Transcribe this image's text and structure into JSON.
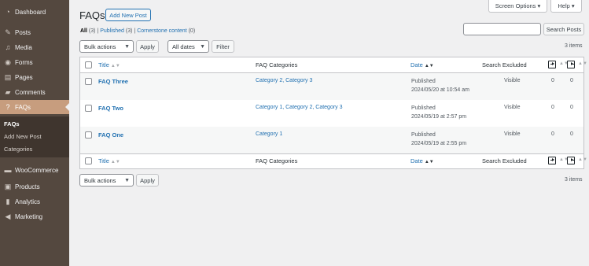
{
  "sidebar": {
    "items": [
      {
        "label": "Dashboard",
        "icon": "dashboard-icon"
      },
      {
        "label": "Posts",
        "icon": "pin-icon"
      },
      {
        "label": "Media",
        "icon": "media-icon"
      },
      {
        "label": "Forms",
        "icon": "forms-icon"
      },
      {
        "label": "Pages",
        "icon": "pages-icon"
      },
      {
        "label": "Comments",
        "icon": "comments-icon"
      },
      {
        "label": "FAQs",
        "icon": "help-icon"
      },
      {
        "label": "WooCommerce",
        "icon": "woocommerce-icon"
      },
      {
        "label": "Products",
        "icon": "products-icon"
      },
      {
        "label": "Analytics",
        "icon": "analytics-icon"
      },
      {
        "label": "Marketing",
        "icon": "megaphone-icon"
      }
    ],
    "submenu": [
      "FAQs",
      "Add New Post",
      "Categories"
    ]
  },
  "top": {
    "screen_options": "Screen Options ▾",
    "help": "Help ▾"
  },
  "header": {
    "title": "FAQs",
    "add_new": "Add New Post"
  },
  "views": {
    "all": "All",
    "all_count": "(3)",
    "published": "Published",
    "published_count": "(3)",
    "cornerstone": "Cornerstone content",
    "cornerstone_count": "(0)",
    "sep": "|"
  },
  "search": {
    "button": "Search Posts",
    "value": ""
  },
  "filters": {
    "bulk": "Bulk actions",
    "apply": "Apply",
    "dates": "All dates",
    "filter": "Filter"
  },
  "items_count": "3 items",
  "table": {
    "headers": {
      "title": "Title",
      "categories": "FAQ Categories",
      "date": "Date",
      "search_excluded": "Search Excluded"
    },
    "rows": [
      {
        "title": "FAQ Three",
        "categories": "Category 2, Category 3",
        "status": "Published",
        "date": "2024/05/20 at 10:54 am",
        "search": "Visible",
        "links_in": "0",
        "links_out": "0"
      },
      {
        "title": "FAQ Two",
        "categories": "Category 1, Category 2, Category 3",
        "status": "Published",
        "date": "2024/05/19 at 2:57 pm",
        "search": "Visible",
        "links_in": "0",
        "links_out": "0"
      },
      {
        "title": "FAQ One",
        "categories": "Category 1",
        "status": "Published",
        "date": "2024/05/19 at 2:55 pm",
        "search": "Visible",
        "links_in": "0",
        "links_out": "0"
      }
    ]
  },
  "colors": {
    "sidebar_bg": "#54483f",
    "active_bg": "#c79d7e",
    "link": "#2271b1"
  }
}
